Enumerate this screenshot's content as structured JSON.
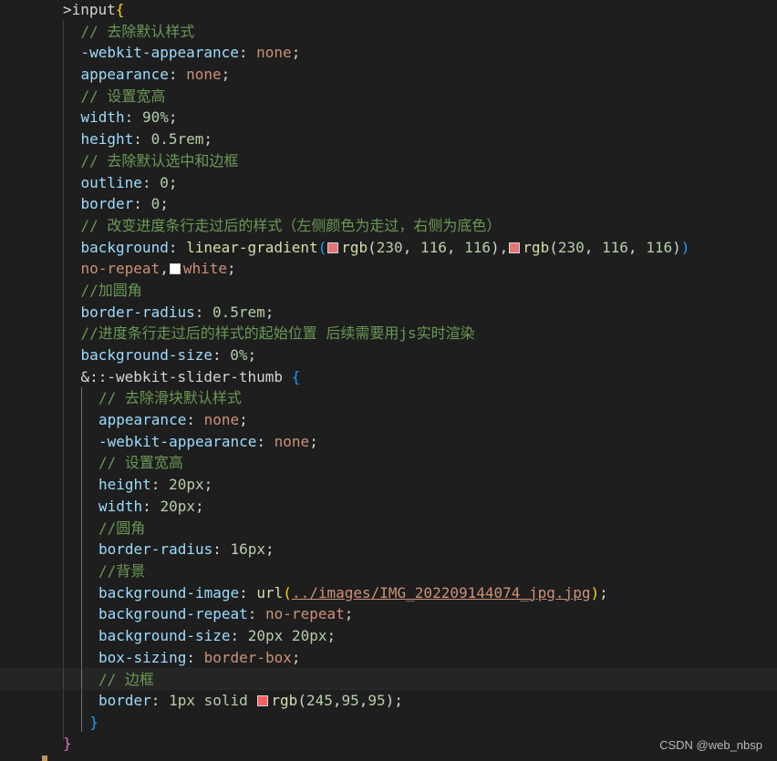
{
  "colors": {
    "background": "#1e1e1e",
    "swatch_rgb_230_116_116": "#e67474",
    "swatch_white": "#ffffff",
    "swatch_rgb_245_95_95": "#f55f5f"
  },
  "lines": [
    {
      "indent": 0,
      "tokens": [
        {
          "text": ">input",
          "c": "c-text"
        },
        {
          "text": "{",
          "c": "c-brace3"
        }
      ]
    },
    {
      "indent": 1,
      "tokens": [
        {
          "text": "// 去除默认样式",
          "c": "c-comment"
        }
      ]
    },
    {
      "indent": 1,
      "tokens": [
        {
          "text": "-webkit-appearance",
          "c": "c-prop"
        },
        {
          "text": ": ",
          "c": "c-text"
        },
        {
          "text": "none",
          "c": "c-kw"
        },
        {
          "text": ";",
          "c": "c-text"
        }
      ]
    },
    {
      "indent": 1,
      "tokens": [
        {
          "text": "appearance",
          "c": "c-prop"
        },
        {
          "text": ": ",
          "c": "c-text"
        },
        {
          "text": "none",
          "c": "c-kw"
        },
        {
          "text": ";",
          "c": "c-text"
        }
      ]
    },
    {
      "indent": 1,
      "tokens": [
        {
          "text": "// 设置宽高",
          "c": "c-comment"
        }
      ]
    },
    {
      "indent": 1,
      "tokens": [
        {
          "text": "width",
          "c": "c-prop"
        },
        {
          "text": ": ",
          "c": "c-text"
        },
        {
          "text": "90%",
          "c": "c-num"
        },
        {
          "text": ";",
          "c": "c-text"
        }
      ]
    },
    {
      "indent": 1,
      "tokens": [
        {
          "text": "height",
          "c": "c-prop"
        },
        {
          "text": ": ",
          "c": "c-text"
        },
        {
          "text": "0.5rem",
          "c": "c-num"
        },
        {
          "text": ";",
          "c": "c-text"
        }
      ]
    },
    {
      "indent": 1,
      "tokens": [
        {
          "text": "// 去除默认选中和边框",
          "c": "c-comment"
        }
      ]
    },
    {
      "indent": 1,
      "tokens": [
        {
          "text": "outline",
          "c": "c-prop"
        },
        {
          "text": ": ",
          "c": "c-text"
        },
        {
          "text": "0",
          "c": "c-num"
        },
        {
          "text": ";",
          "c": "c-text"
        }
      ]
    },
    {
      "indent": 1,
      "tokens": [
        {
          "text": "border",
          "c": "c-prop"
        },
        {
          "text": ": ",
          "c": "c-text"
        },
        {
          "text": "0",
          "c": "c-num"
        },
        {
          "text": ";",
          "c": "c-text"
        }
      ]
    },
    {
      "indent": 1,
      "tokens": [
        {
          "text": "// 改变进度条行走过后的样式（左侧颜色为走过，右侧为底色）",
          "c": "c-comment"
        }
      ]
    },
    {
      "indent": 1,
      "tokens": [
        {
          "text": "background",
          "c": "c-prop"
        },
        {
          "text": ": ",
          "c": "c-text"
        },
        {
          "text": "linear-gradient",
          "c": "c-fn"
        },
        {
          "text": "(",
          "c": "c-brace2"
        },
        {
          "swatch": "#e67474",
          "name": "color-swatch-rgb-230-116-116"
        },
        {
          "text": "rgb",
          "c": "c-fn"
        },
        {
          "text": "(",
          "c": "c-text"
        },
        {
          "text": "230",
          "c": "c-num"
        },
        {
          "text": ", ",
          "c": "c-text"
        },
        {
          "text": "116",
          "c": "c-num"
        },
        {
          "text": ", ",
          "c": "c-text"
        },
        {
          "text": "116",
          "c": "c-num"
        },
        {
          "text": "),",
          "c": "c-text"
        },
        {
          "swatch": "#e67474",
          "name": "color-swatch-rgb-230-116-116"
        },
        {
          "text": "rgb",
          "c": "c-fn"
        },
        {
          "text": "(",
          "c": "c-text"
        },
        {
          "text": "230",
          "c": "c-num"
        },
        {
          "text": ", ",
          "c": "c-text"
        },
        {
          "text": "116",
          "c": "c-num"
        },
        {
          "text": ", ",
          "c": "c-text"
        },
        {
          "text": "116",
          "c": "c-num"
        },
        {
          "text": ")",
          "c": "c-text"
        },
        {
          "text": ")",
          "c": "c-brace2"
        }
      ]
    },
    {
      "indent": 1,
      "tokens": [
        {
          "text": "no-repeat",
          "c": "c-kw"
        },
        {
          "text": ",",
          "c": "c-text"
        },
        {
          "swatch": "#ffffff",
          "name": "color-swatch-white"
        },
        {
          "text": "white",
          "c": "c-kw"
        },
        {
          "text": ";",
          "c": "c-text"
        }
      ]
    },
    {
      "indent": 1,
      "tokens": [
        {
          "text": "//加圆角",
          "c": "c-comment"
        }
      ]
    },
    {
      "indent": 1,
      "tokens": [
        {
          "text": "border-radius",
          "c": "c-prop"
        },
        {
          "text": ": ",
          "c": "c-text"
        },
        {
          "text": "0.5rem",
          "c": "c-num"
        },
        {
          "text": ";",
          "c": "c-text"
        }
      ]
    },
    {
      "indent": 1,
      "tokens": [
        {
          "text": "//进度条行走过后的样式的起始位置 后续需要用js实时渲染",
          "c": "c-comment"
        }
      ]
    },
    {
      "indent": 1,
      "tokens": [
        {
          "text": "background-size",
          "c": "c-prop"
        },
        {
          "text": ": ",
          "c": "c-text"
        },
        {
          "text": "0%",
          "c": "c-num"
        },
        {
          "text": ";",
          "c": "c-text"
        }
      ]
    },
    {
      "indent": 1,
      "tokens": [
        {
          "text": "&::-webkit-slider-thumb",
          "c": "c-text"
        },
        {
          "text": " ",
          "c": "c-text"
        },
        {
          "text": "{",
          "c": "c-brace2"
        }
      ]
    },
    {
      "indent": 2,
      "tokens": [
        {
          "text": "// 去除滑块默认样式",
          "c": "c-comment"
        }
      ]
    },
    {
      "indent": 2,
      "tokens": [
        {
          "text": "appearance",
          "c": "c-prop"
        },
        {
          "text": ": ",
          "c": "c-text"
        },
        {
          "text": "none",
          "c": "c-kw"
        },
        {
          "text": ";",
          "c": "c-text"
        }
      ]
    },
    {
      "indent": 2,
      "tokens": [
        {
          "text": "-webkit-appearance",
          "c": "c-prop"
        },
        {
          "text": ": ",
          "c": "c-text"
        },
        {
          "text": "none",
          "c": "c-kw"
        },
        {
          "text": ";",
          "c": "c-text"
        }
      ]
    },
    {
      "indent": 2,
      "tokens": [
        {
          "text": "// 设置宽高",
          "c": "c-comment"
        }
      ]
    },
    {
      "indent": 2,
      "tokens": [
        {
          "text": "height",
          "c": "c-prop"
        },
        {
          "text": ": ",
          "c": "c-text"
        },
        {
          "text": "20px",
          "c": "c-num"
        },
        {
          "text": ";",
          "c": "c-text"
        }
      ]
    },
    {
      "indent": 2,
      "tokens": [
        {
          "text": "width",
          "c": "c-prop"
        },
        {
          "text": ": ",
          "c": "c-text"
        },
        {
          "text": "20px",
          "c": "c-num"
        },
        {
          "text": ";",
          "c": "c-text"
        }
      ]
    },
    {
      "indent": 2,
      "tokens": [
        {
          "text": "//圆角",
          "c": "c-comment"
        }
      ]
    },
    {
      "indent": 2,
      "tokens": [
        {
          "text": "border-radius",
          "c": "c-prop"
        },
        {
          "text": ": ",
          "c": "c-text"
        },
        {
          "text": "16px",
          "c": "c-num"
        },
        {
          "text": ";",
          "c": "c-text"
        }
      ]
    },
    {
      "indent": 2,
      "tokens": [
        {
          "text": "//背景",
          "c": "c-comment"
        }
      ]
    },
    {
      "indent": 2,
      "tokens": [
        {
          "text": "background-image",
          "c": "c-prop"
        },
        {
          "text": ": ",
          "c": "c-text"
        },
        {
          "text": "url",
          "c": "c-fn"
        },
        {
          "text": "(",
          "c": "c-brace3"
        },
        {
          "text": "../images/IMG_202209144074_jpg.jpg",
          "c": "c-url"
        },
        {
          "text": ")",
          "c": "c-brace3"
        },
        {
          "text": ";",
          "c": "c-text"
        }
      ]
    },
    {
      "indent": 2,
      "tokens": [
        {
          "text": "background-repeat",
          "c": "c-prop"
        },
        {
          "text": ": ",
          "c": "c-text"
        },
        {
          "text": "no-repeat",
          "c": "c-kw"
        },
        {
          "text": ";",
          "c": "c-text"
        }
      ]
    },
    {
      "indent": 2,
      "tokens": [
        {
          "text": "background-size",
          "c": "c-prop"
        },
        {
          "text": ": ",
          "c": "c-text"
        },
        {
          "text": "20px 20px",
          "c": "c-num"
        },
        {
          "text": ";",
          "c": "c-text"
        }
      ]
    },
    {
      "indent": 2,
      "tokens": [
        {
          "text": "box-sizing",
          "c": "c-prop"
        },
        {
          "text": ": ",
          "c": "c-text"
        },
        {
          "text": "border-box",
          "c": "c-kw"
        },
        {
          "text": ";",
          "c": "c-text"
        }
      ]
    },
    {
      "indent": 2,
      "current": true,
      "tokens": [
        {
          "text": "// 边框",
          "c": "c-comment"
        }
      ]
    },
    {
      "indent": 2,
      "tokens": [
        {
          "text": "border",
          "c": "c-prop"
        },
        {
          "text": ": ",
          "c": "c-text"
        },
        {
          "text": "1px",
          "c": "c-num"
        },
        {
          "text": " solid ",
          "c": "c-num"
        },
        {
          "swatch": "#f55f5f",
          "name": "color-swatch-rgb-245-95-95"
        },
        {
          "text": "rgb",
          "c": "c-fn"
        },
        {
          "text": "(",
          "c": "c-text"
        },
        {
          "text": "245",
          "c": "c-num"
        },
        {
          "text": ",",
          "c": "c-text"
        },
        {
          "text": "95",
          "c": "c-num"
        },
        {
          "text": ",",
          "c": "c-text"
        },
        {
          "text": "95",
          "c": "c-num"
        },
        {
          "text": ");",
          "c": "c-text"
        }
      ]
    },
    {
      "indent": 1.5,
      "tokens": [
        {
          "text": "}",
          "c": "c-brace2"
        }
      ]
    },
    {
      "indent": 0,
      "tokens": [
        {
          "text": "}",
          "c": "c-brace1"
        }
      ]
    }
  ],
  "watermark": "CSDN @web_nbsp"
}
